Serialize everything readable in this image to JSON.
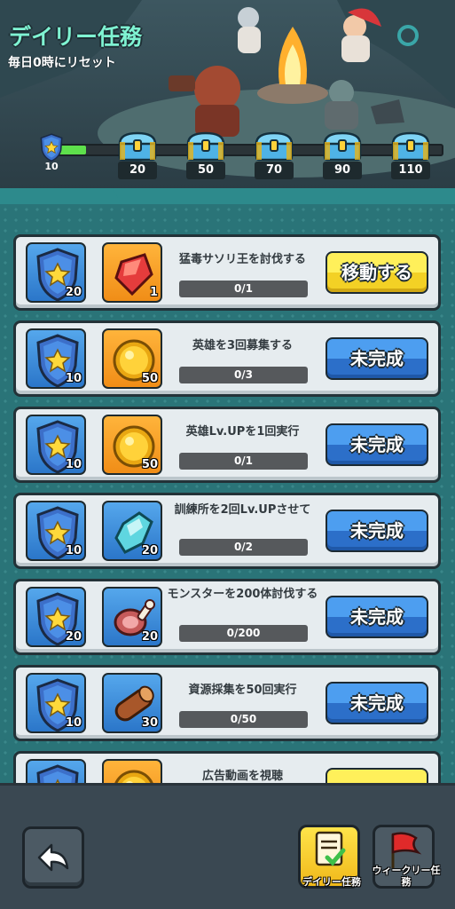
{
  "header": {
    "title": "デイリー任務",
    "subtitle": "毎日0時にリセット",
    "progress": {
      "level": "10",
      "fill_fraction": 0.08,
      "milestones": [
        "20",
        "50",
        "70",
        "90",
        "110"
      ]
    }
  },
  "tasks": [
    {
      "title": "猛毒サソリ王を討伐する",
      "progress": "0/1",
      "point_reward": "20",
      "item_reward": "1",
      "item_icon": "red-crystal-icon",
      "button": "移動する",
      "button_style": "yellow"
    },
    {
      "title": "英雄を3回募集する",
      "progress": "0/3",
      "point_reward": "10",
      "item_reward": "50",
      "item_icon": "gold-coin-icon",
      "button": "未完成",
      "button_style": "blue"
    },
    {
      "title": "英雄Lv.UPを1回実行",
      "progress": "0/1",
      "point_reward": "10",
      "item_reward": "50",
      "item_icon": "gold-coin-icon",
      "button": "未完成",
      "button_style": "blue"
    },
    {
      "title": "訓練所を2回Lv.UPさせて",
      "progress": "0/2",
      "point_reward": "10",
      "item_reward": "20",
      "item_icon": "blue-crystal-icon",
      "button": "未完成",
      "button_style": "blue"
    },
    {
      "title": "モンスターを200体討伐する",
      "progress": "0/200",
      "point_reward": "20",
      "item_reward": "20",
      "item_icon": "meat-icon",
      "button": "未完成",
      "button_style": "blue"
    },
    {
      "title": "資源採集を50回実行",
      "progress": "0/50",
      "point_reward": "10",
      "item_reward": "30",
      "item_icon": "wood-log-icon",
      "button": "未完成",
      "button_style": "blue"
    },
    {
      "title": "広告動画を視聴",
      "progress": "",
      "point_reward": "",
      "item_reward": "",
      "item_icon": "gold-coin-icon",
      "button": "",
      "button_style": "yellow"
    }
  ],
  "footer": {
    "daily_tab": "デイリー任務",
    "weekly_tab": "ウィークリー任務"
  },
  "colors": {
    "title": "#7ff3d2",
    "progress_fill": "#5ee04c",
    "button_blue": "#3a86e0",
    "button_yellow": "#f7dd35",
    "list_bg": "#2a7478"
  }
}
